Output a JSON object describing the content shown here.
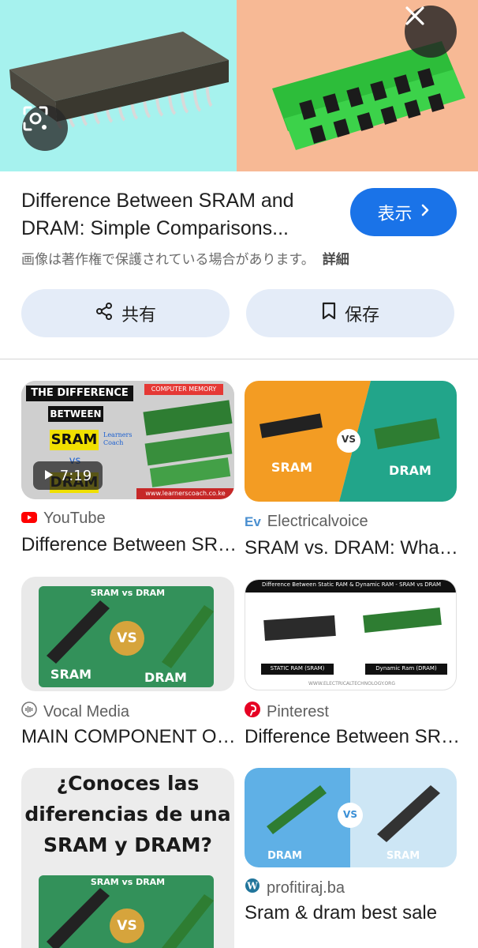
{
  "hero": {
    "left_bg": "#a6f2ee",
    "right_bg": "#f7b995",
    "lens_icon": "google-lens-icon",
    "close_icon": "close-icon"
  },
  "header": {
    "title_line1": "Difference Between SRAM and",
    "title_line2": "DRAM: Simple Comparisons...",
    "view_label": "表示",
    "copyright_text": "画像は著作権で保護されている場合があります。",
    "details_label": "詳細",
    "share_label": "共有",
    "save_label": "保存",
    "accent": "#1a73e8"
  },
  "results": [
    {
      "source": "YouTube",
      "title": "Difference Between SRAM and DRAM",
      "duration": "7:19",
      "img_text": {
        "line1": "THE DIFFERENCE",
        "line2": "BETWEEN",
        "line3": "SRAM",
        "line4": "vs",
        "line5": "DRAM",
        "badge": "COMPUTER MEMORY",
        "logo": "Learners Coach",
        "url": "www.learnerscoach.co.ke"
      }
    },
    {
      "source": "Electricalvoice",
      "source_badge": "Ev",
      "title": "SRAM vs. DRAM: What's the difference",
      "img_text": {
        "left": "SRAM",
        "vs": "VS",
        "right": "DRAM"
      }
    },
    {
      "source": "Vocal Media",
      "title": "MAIN COMPONENT OF COMPUTER",
      "img_text": {
        "top": "SRAM vs DRAM",
        "vs": "VS",
        "left": "SRAM",
        "right": "DRAM"
      }
    },
    {
      "source": "Pinterest",
      "title": "Difference Between SRAM and DRAM",
      "img_text": {
        "header": "Difference Between Static RAM & Dynamic RAM - SRAM vs DRAM",
        "left": "STATIC RAM (SRAM)",
        "right": "Dynamic Ram (DRAM)",
        "url": "WWW.ELECTRICALTECHNOLOGY.ORG"
      }
    },
    {
      "img_text": {
        "line1": "¿Conoces las",
        "line2": "diferencias de una",
        "line3": "SRAM y DRAM?",
        "top": "SRAM vs DRAM",
        "vs": "VS"
      }
    },
    {
      "source": "profitiraj.ba",
      "title": "Sram & dram best sale",
      "img_text": {
        "vs": "VS",
        "left": "DRAM",
        "right": "SRAM"
      }
    }
  ]
}
